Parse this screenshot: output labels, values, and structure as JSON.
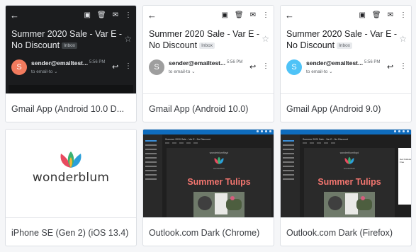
{
  "cards": [
    {
      "caption": "Gmail App (Android 10.0 D...",
      "email": {
        "subject": "Summer 2020 Sale - Var E - No Discount",
        "badge": "Inbox",
        "avatar_letter": "S",
        "avatar_color": "#f27b5e",
        "sender": "sender@emailtest...",
        "time": "5:56 PM",
        "to": "to email-to ⌄"
      }
    },
    {
      "caption": "Gmail App (Android 10.0)",
      "email": {
        "subject": "Summer 2020 Sale - Var E - No Discount",
        "badge": "Inbox",
        "avatar_letter": "S",
        "avatar_color": "#9e9e9e",
        "sender": "sender@emailtest...",
        "time": "5:56 PM",
        "to": "to email-to ⌄"
      }
    },
    {
      "caption": "Gmail App (Android 9.0)",
      "email": {
        "subject": "Summer 2020 Sale - Var E - No Discount",
        "badge": "Inbox",
        "avatar_letter": "S",
        "avatar_color": "#4fc3f7",
        "sender": "sender@emailtest...",
        "time": "5:56 PM",
        "to": "to email-to ⌄"
      }
    },
    {
      "caption": "iPhone SE (Gen 2) (iOS 13.4)",
      "brand": "wonderblum"
    },
    {
      "caption": "Outlook.com Dark (Chrome)",
      "outlook": {
        "mail_header": "Summer 2020 Sale - Var E - No Discount",
        "brand": "wonderblumfloyd",
        "brand_sub": "wonderblum",
        "headline": "Summer Tulips"
      }
    },
    {
      "caption": "Outlook.com Dark (Firefox)",
      "outlook": {
        "mail_header": "Summer 2020 Sale - Var E - No Discount",
        "brand": "wonderblumfloyd",
        "brand_sub": "wonderblum",
        "headline": "Summer Tulips",
        "ad_text": "Get Outlook Free"
      }
    }
  ],
  "colors": {
    "accent_outlook": "#0f6cbd",
    "headline": "#f2756f",
    "logo_petals": [
      "#e84a5f",
      "#3bb273",
      "#2b9fd9",
      "#f7b733"
    ]
  }
}
